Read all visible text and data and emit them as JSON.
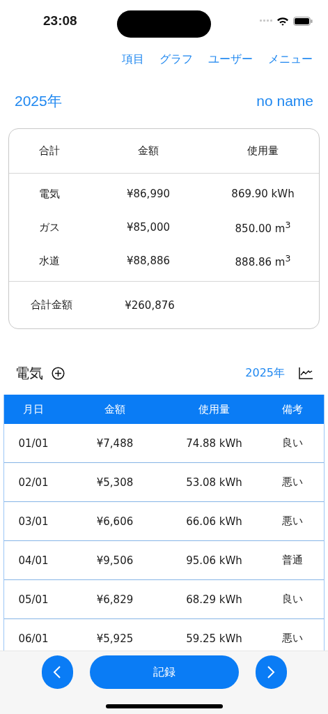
{
  "status_bar": {
    "time": "23:08"
  },
  "nav_links": [
    "項目",
    "グラフ",
    "ユーザー",
    "メニュー"
  ],
  "header": {
    "year": "2025年",
    "user": "no name"
  },
  "summary": {
    "columns": [
      "合計",
      "金額",
      "使用量"
    ],
    "rows": [
      {
        "name": "電気",
        "amount": "¥86,990",
        "usage": "869.90 kWh"
      },
      {
        "name": "ガス",
        "amount": "¥85,000",
        "usage": "850.00 m$^{3}$"
      },
      {
        "name": "水道",
        "amount": "¥88,886",
        "usage": "888.86 m$^{3}$"
      }
    ],
    "total_label": "合計金額",
    "total_amount": "¥260,876"
  },
  "section": {
    "title": "電気",
    "year": "2025年"
  },
  "table": {
    "columns": [
      "月日",
      "金額",
      "使用量",
      "備考"
    ],
    "rows": [
      [
        "01/01",
        "¥7,488",
        "74.88 kWh",
        "良い"
      ],
      [
        "02/01",
        "¥5,308",
        "53.08 kWh",
        "悪い"
      ],
      [
        "03/01",
        "¥6,606",
        "66.06 kWh",
        "悪い"
      ],
      [
        "04/01",
        "¥9,506",
        "95.06 kWh",
        "普通"
      ],
      [
        "05/01",
        "¥6,829",
        "68.29 kWh",
        "良い"
      ],
      [
        "06/01",
        "¥5,925",
        "59.25 kWh",
        "悪い"
      ]
    ]
  },
  "bottom_bar": {
    "record_button": "記録"
  }
}
